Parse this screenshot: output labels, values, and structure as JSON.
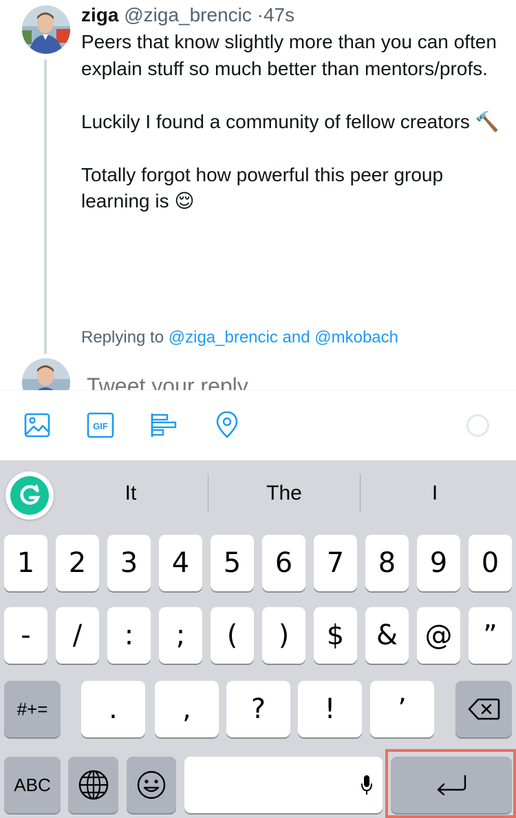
{
  "tweet": {
    "author_name": "ziga",
    "author_handle": "@ziga_brencic",
    "separator": "·",
    "time": "47s",
    "paragraphs": [
      "Peers that know slightly more than you can often explain stuff so much better than mentors/profs.",
      "Luckily I found a community of fellow creators",
      "Totally forgot how powerful this peer group learning is"
    ],
    "emoji_1": "🔨",
    "emoji_2": "😌"
  },
  "reply": {
    "replying_prefix": "Replying to",
    "replying_to": "@ziga_brencic and @mkobach",
    "placeholder": "Tweet your reply"
  },
  "toolbar": {
    "icons": [
      "image-icon",
      "gif-icon",
      "poll-icon",
      "location-icon"
    ],
    "gif_label": "GIF"
  },
  "keyboard": {
    "suggestions": [
      "It",
      "The",
      "I"
    ],
    "row1": [
      "1",
      "2",
      "3",
      "4",
      "5",
      "6",
      "7",
      "8",
      "9",
      "0"
    ],
    "row2": [
      "-",
      "/",
      ":",
      ";",
      "(",
      ")",
      "$",
      "&",
      "@",
      "”"
    ],
    "row3": [
      ".",
      ",",
      "?",
      "!",
      "’"
    ],
    "symbols_key": "#+=",
    "abc_key": "ABC"
  },
  "colors": {
    "accent": "#1d9bf0",
    "grammarly": "#15c39a",
    "highlight": "#e8705e"
  }
}
